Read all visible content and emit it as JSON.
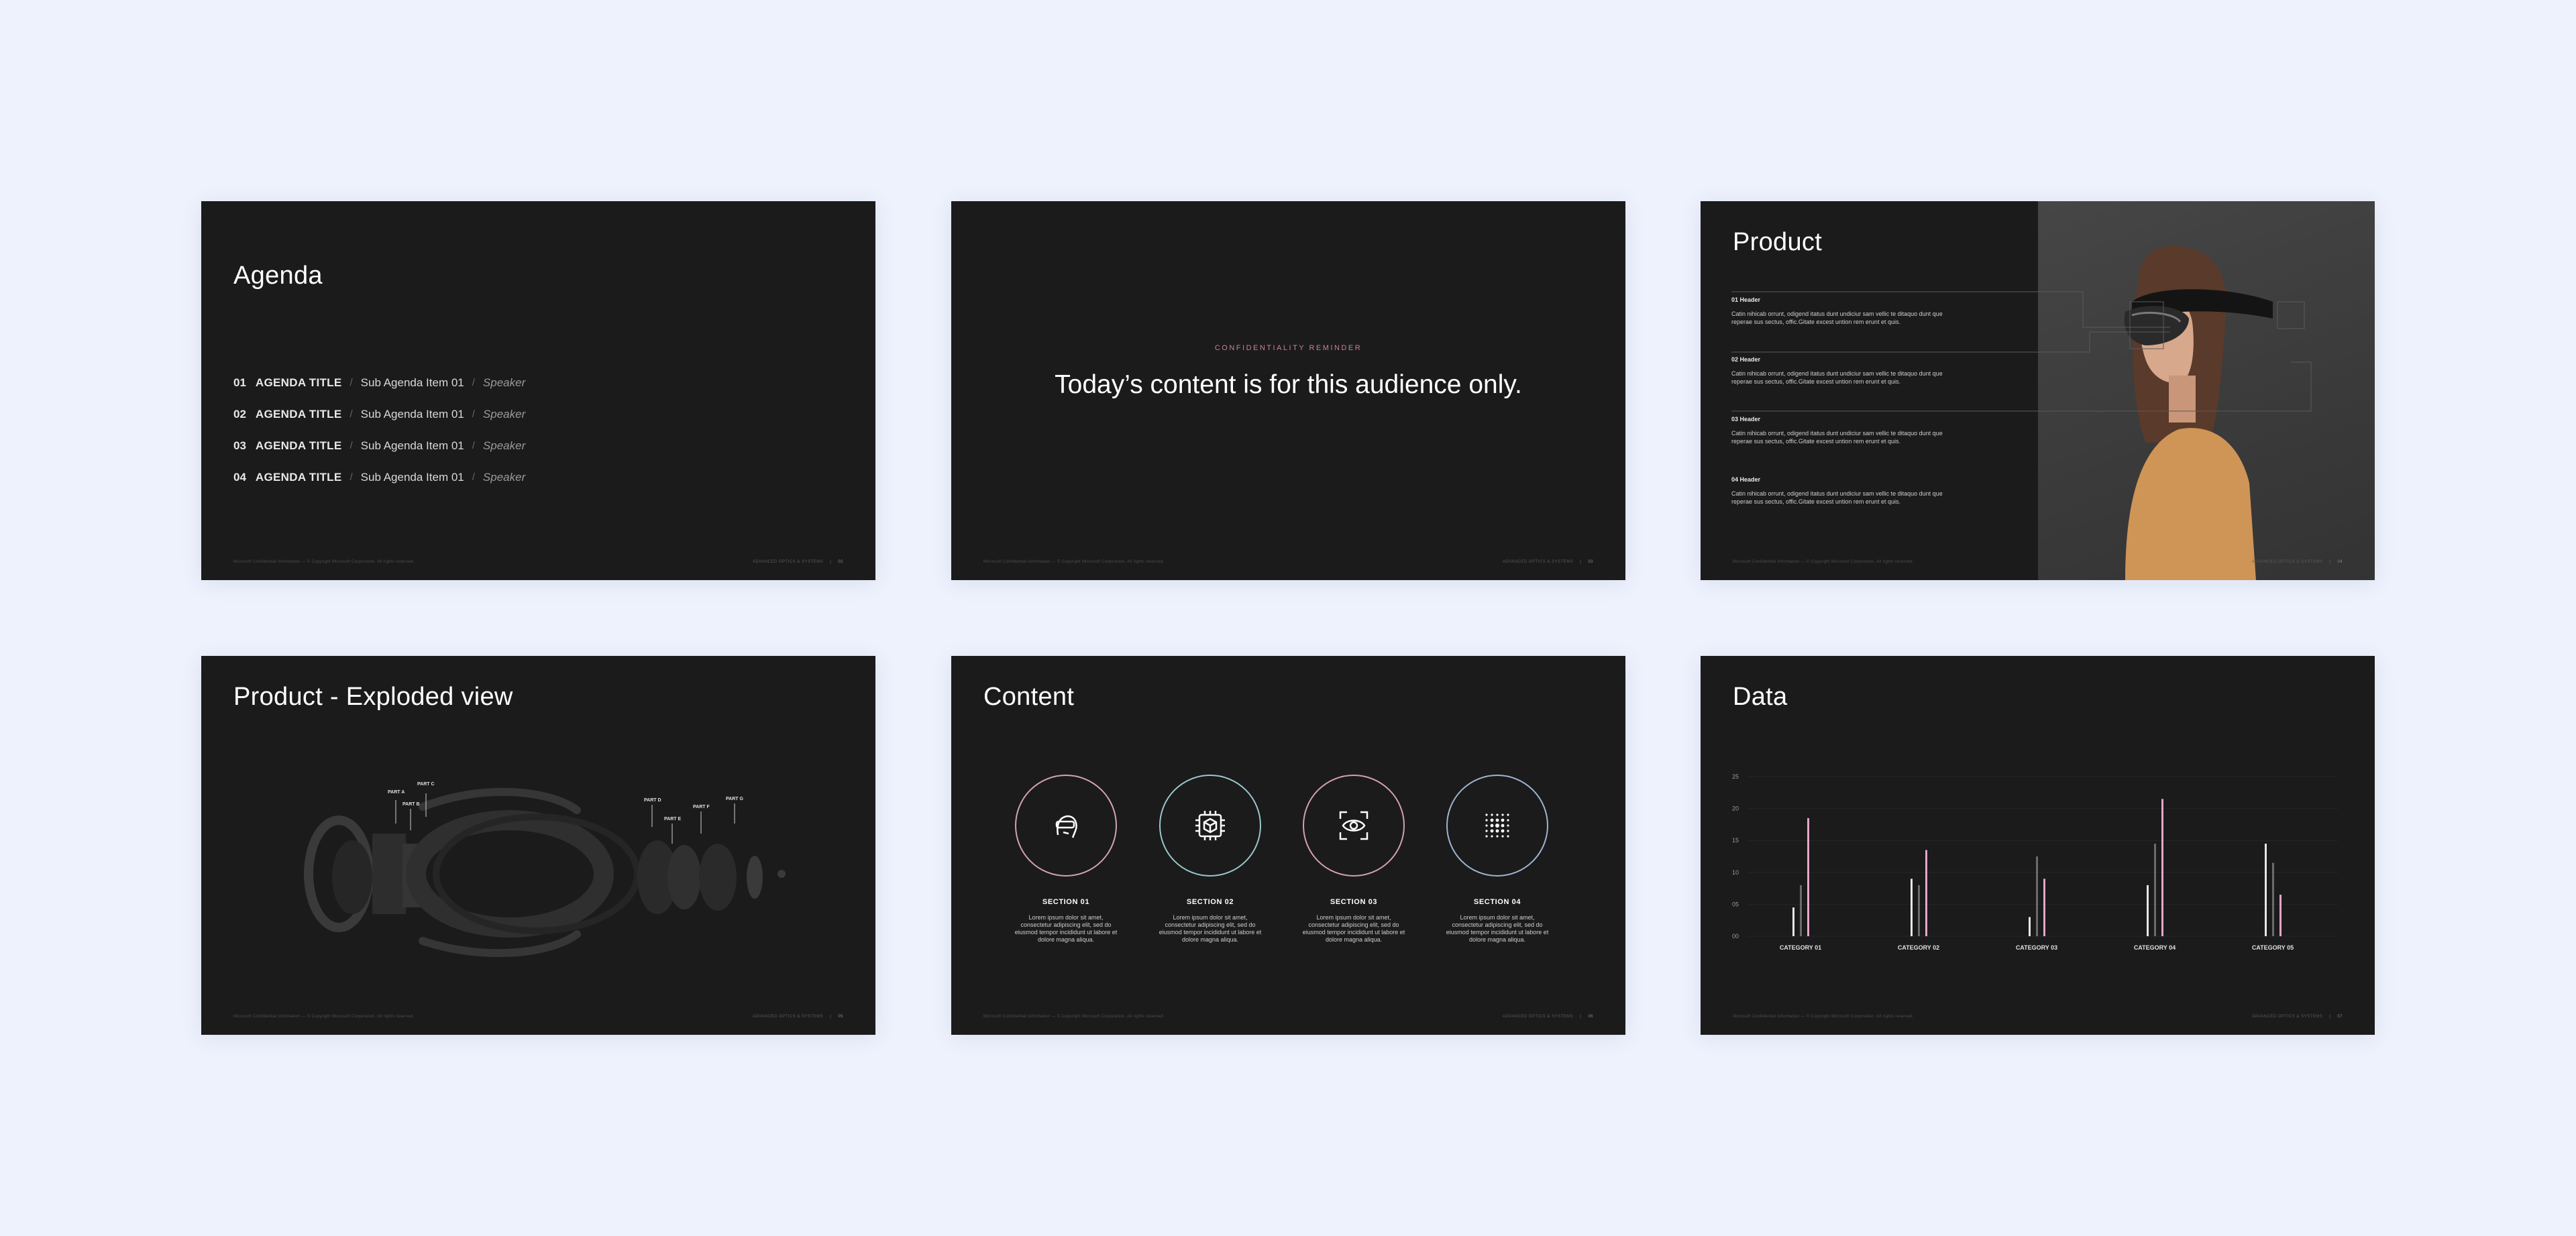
{
  "footer": {
    "legal": "Microsoft Confidential Information — © Copyright Microsoft Corporation. All rights reserved.",
    "brand": "ADVANCED OPTICS & SYSTEMS"
  },
  "slides": {
    "agenda": {
      "title": "Agenda",
      "page": "02",
      "items": [
        {
          "num": "01",
          "title": "AGENDA TITLE",
          "sub": "Sub Agenda Item 01",
          "speaker": "Speaker"
        },
        {
          "num": "02",
          "title": "AGENDA TITLE",
          "sub": "Sub Agenda Item 01",
          "speaker": "Speaker"
        },
        {
          "num": "03",
          "title": "AGENDA TITLE",
          "sub": "Sub Agenda Item 01",
          "speaker": "Speaker"
        },
        {
          "num": "04",
          "title": "AGENDA TITLE",
          "sub": "Sub Agenda Item 01",
          "speaker": "Speaker"
        }
      ]
    },
    "confidentiality": {
      "label": "CONFIDENTIALITY REMINDER",
      "text": "Today’s content is for this audience only.",
      "page": "03"
    },
    "product": {
      "title": "Product",
      "page": "04",
      "blocks": [
        {
          "header": "01 Header",
          "body": "Catin nihicab orrunt, odigend itatus dunt undiciur sam vellic te ditaquo dunt que reperae sus sectus, offic.Gitate excest untion rem erunt et quis."
        },
        {
          "header": "02 Header",
          "body": "Catin nihicab orrunt, odigend itatus dunt undiciur sam vellic te ditaquo dunt que reperae sus sectus, offic.Gitate excest untion rem erunt et quis."
        },
        {
          "header": "03 Header",
          "body": "Catin nihicab orrunt, odigend itatus dunt undiciur sam vellic te ditaquo dunt que reperae sus sectus, offic.Gitate excest untion rem erunt et quis."
        },
        {
          "header": "04 Header",
          "body": "Catin nihicab orrunt, odigend itatus dunt undiciur sam vellic te ditaquo dunt que reperae sus sectus, offic.Gitate excest untion rem erunt et quis."
        }
      ]
    },
    "exploded": {
      "title": "Product - Exploded view",
      "page": "05",
      "parts": [
        "PART A",
        "PART B",
        "PART C",
        "PART D",
        "PART E",
        "PART F",
        "PART G"
      ]
    },
    "content": {
      "title": "Content",
      "page": "06",
      "sections": [
        {
          "title": "SECTION 01",
          "icon": "person-headset-icon",
          "ring_color": "#d4a2b6",
          "body": "Lorem ipsum dolor sit amet, consectetur adipiscing elit, sed do eiusmod tempor incididunt ut labore et dolore magna aliqua."
        },
        {
          "title": "SECTION 02",
          "icon": "chip-cube-icon",
          "ring_color": "#9ac7cc",
          "body": "Lorem ipsum dolor sit amet, consectetur adipiscing elit, sed do eiusmod tempor incididunt ut labore et dolore magna aliqua."
        },
        {
          "title": "SECTION 03",
          "icon": "eye-scan-icon",
          "ring_color": "#d59fb4",
          "body": "Lorem ipsum dolor sit amet, consectetur adipiscing elit, sed do eiusmod tempor incididunt ut labore et dolore magna aliqua."
        },
        {
          "title": "SECTION 04",
          "icon": "dot-grid-icon",
          "ring_color": "#9fb4d2",
          "body": "Lorem ipsum dolor sit amet, consectetur adipiscing elit, sed do eiusmod tempor incididunt ut labore et dolore magna aliqua."
        }
      ]
    },
    "data": {
      "title": "Data",
      "page": "07"
    }
  },
  "chart_data": {
    "type": "bar",
    "categories": [
      "CATEGORY 01",
      "CATEGORY 02",
      "CATEGORY 03",
      "CATEGORY 04",
      "CATEGORY 05"
    ],
    "y_ticks": [
      "00",
      "05",
      "10",
      "15",
      "20",
      "25"
    ],
    "ylim": [
      0,
      25
    ],
    "grid": true,
    "series": [
      {
        "values": [
          4.5,
          9.0,
          3.0,
          8.0,
          14.5
        ],
        "color": "#e6e6e6"
      },
      {
        "values": [
          8.0,
          8.0,
          12.5,
          14.5,
          11.5
        ],
        "color": "#6b6b6b"
      },
      {
        "values": [
          18.5,
          13.5,
          9.0,
          21.5,
          6.5
        ],
        "color": "#e6a6c9"
      }
    ]
  }
}
